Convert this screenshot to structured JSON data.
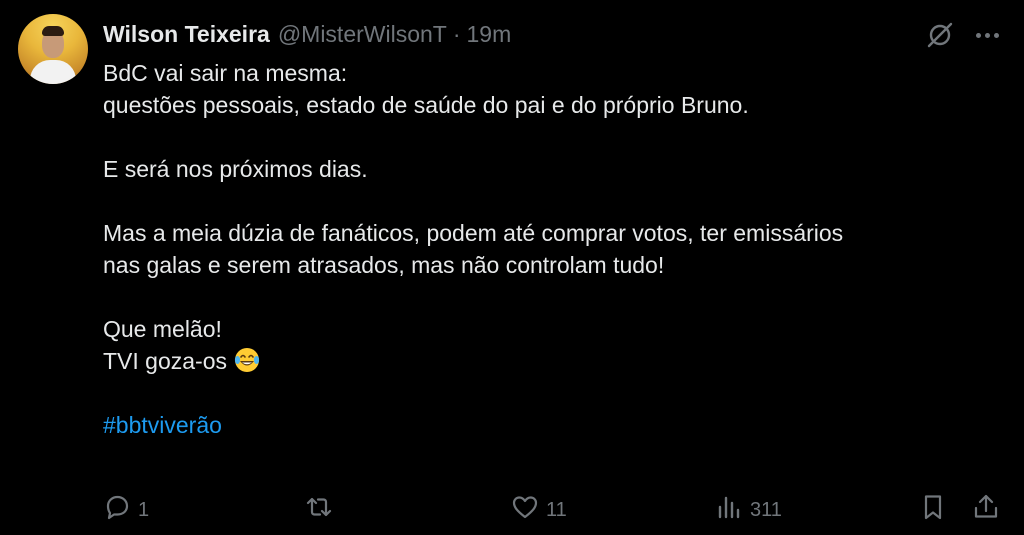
{
  "tweet": {
    "author": {
      "display_name": "Wilson Teixeira",
      "handle": "@MisterWilsonT",
      "separator": "·",
      "time": "19m",
      "avatar_icon": "profile-photo"
    },
    "text_lines": [
      "BdC vai sair na mesma:",
      "questões pessoais, estado de saúde do pai e do próprio Bruno.",
      "",
      "E será nos próximos dias.",
      "",
      "Mas a meia dúzia de fanáticos, podem até comprar votos, ter emissários",
      "nas galas e serem atrasados, mas não controlam tudo!",
      "",
      "Que melão!",
      "TVI goza-os"
    ],
    "emoji": "😂",
    "hashtag": "#bbtviverão",
    "hashtag_color": "#1d9bf0",
    "actions": {
      "reply": {
        "icon": "reply-icon",
        "count": "1"
      },
      "retweet": {
        "icon": "retweet-icon",
        "count": ""
      },
      "like": {
        "icon": "heart-icon",
        "count": "11"
      },
      "views": {
        "icon": "views-icon",
        "count": "311"
      },
      "bookmark": {
        "icon": "bookmark-icon"
      },
      "share": {
        "icon": "share-icon"
      }
    },
    "top_icons": [
      "grok-icon",
      "more-icon"
    ]
  }
}
